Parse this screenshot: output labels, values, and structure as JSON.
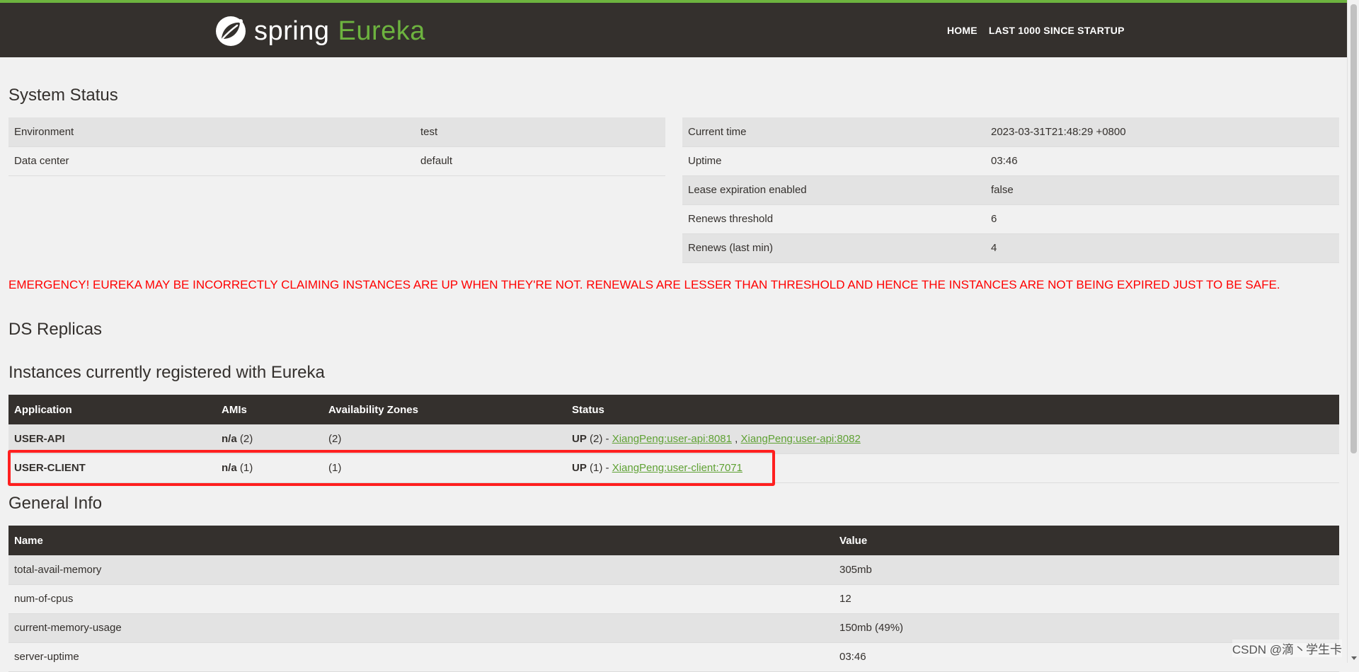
{
  "header": {
    "logo_spring": "spring",
    "logo_eureka": "Eureka",
    "logo_icon": "spring-leaf-icon",
    "nav": [
      "HOME",
      "LAST 1000 SINCE STARTUP"
    ]
  },
  "system_status": {
    "title": "System Status",
    "left": [
      {
        "label": "Environment",
        "value": "test"
      },
      {
        "label": "Data center",
        "value": "default"
      }
    ],
    "right": [
      {
        "label": "Current time",
        "value": "2023-03-31T21:48:29 +0800"
      },
      {
        "label": "Uptime",
        "value": "03:46"
      },
      {
        "label": "Lease expiration enabled",
        "value": "false"
      },
      {
        "label": "Renews threshold",
        "value": "6"
      },
      {
        "label": "Renews (last min)",
        "value": "4"
      }
    ]
  },
  "emergency": "EMERGENCY! EUREKA MAY BE INCORRECTLY CLAIMING INSTANCES ARE UP WHEN THEY'RE NOT. RENEWALS ARE LESSER THAN THRESHOLD AND HENCE THE INSTANCES ARE NOT BEING EXPIRED JUST TO BE SAFE.",
  "ds_replicas": {
    "title": "DS Replicas"
  },
  "instances": {
    "title": "Instances currently registered with Eureka",
    "headers": [
      "Application",
      "AMIs",
      "Availability Zones",
      "Status"
    ],
    "rows": [
      {
        "app": "USER-API",
        "ami_bold": "n/a",
        "ami_count": " (2)",
        "zones": "(2)",
        "status_bold": "UP",
        "status_count": " (2) - ",
        "link1": "XiangPeng:user-api:8081",
        "sep": " , ",
        "link2": "XiangPeng:user-api:8082"
      },
      {
        "app": "USER-CLIENT",
        "ami_bold": "n/a",
        "ami_count": " (1)",
        "zones": "(1)",
        "status_bold": "UP",
        "status_count": " (1) - ",
        "link1": "XiangPeng:user-client:7071"
      }
    ]
  },
  "general_info": {
    "title": "General Info",
    "headers": [
      "Name",
      "Value"
    ],
    "rows": [
      {
        "name": "total-avail-memory",
        "value": "305mb"
      },
      {
        "name": "num-of-cpus",
        "value": "12"
      },
      {
        "name": "current-memory-usage",
        "value": "150mb (49%)"
      },
      {
        "name": "server-uptime",
        "value": "03:46"
      }
    ]
  },
  "watermark": "CSDN @滴丶学生卡",
  "colors": {
    "brand_green": "#6db33f",
    "header_bg": "#34302d",
    "emergency_red": "#ff0000",
    "highlight_red": "#ff1f1f"
  }
}
